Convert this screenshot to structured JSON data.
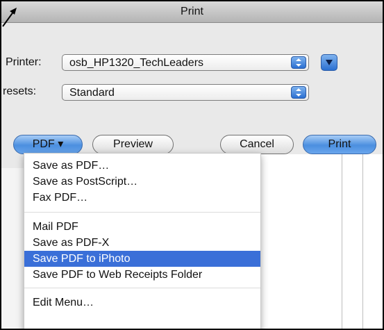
{
  "window": {
    "title": "Print"
  },
  "printer": {
    "label": "Printer:",
    "value": "osb_HP1320_TechLeaders"
  },
  "presets": {
    "label": "resets:",
    "value": "Standard"
  },
  "buttons": {
    "pdf": "PDF ▾",
    "preview": "Preview",
    "cancel": "Cancel",
    "print": "Print"
  },
  "menu": {
    "items": [
      "Save as PDF…",
      "Save as PostScript…",
      "Fax PDF…",
      "Mail PDF",
      "Save as PDF-X",
      "Save PDF to iPhoto",
      "Save PDF to Web Receipts Folder",
      "Edit Menu…"
    ],
    "selected": "Save PDF to iPhoto"
  },
  "colors": {
    "accent": "#3a6fd8",
    "button_blue": "#4b8fe0"
  }
}
